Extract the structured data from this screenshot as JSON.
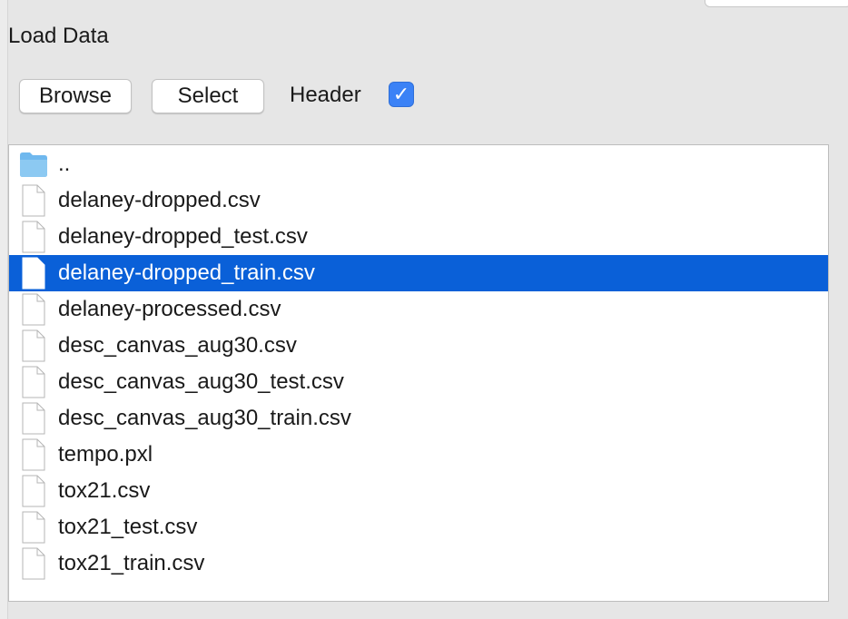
{
  "panel": {
    "title": "Load Data"
  },
  "toolbar": {
    "browse_label": "Browse",
    "select_label": "Select",
    "header_label": "Header",
    "header_checked": true,
    "checkmark": "✓"
  },
  "files": [
    {
      "name": "..",
      "icon": "folder-icon",
      "selected": false
    },
    {
      "name": "delaney-dropped.csv",
      "icon": "file-icon",
      "selected": false
    },
    {
      "name": "delaney-dropped_test.csv",
      "icon": "file-icon",
      "selected": false
    },
    {
      "name": "delaney-dropped_train.csv",
      "icon": "file-icon",
      "selected": true
    },
    {
      "name": "delaney-processed.csv",
      "icon": "file-icon",
      "selected": false
    },
    {
      "name": "desc_canvas_aug30.csv",
      "icon": "file-icon",
      "selected": false
    },
    {
      "name": "desc_canvas_aug30_test.csv",
      "icon": "file-icon",
      "selected": false
    },
    {
      "name": "desc_canvas_aug30_train.csv",
      "icon": "file-icon",
      "selected": false
    },
    {
      "name": "tempo.pxl",
      "icon": "file-icon",
      "selected": false
    },
    {
      "name": "tox21.csv",
      "icon": "file-icon",
      "selected": false
    },
    {
      "name": "tox21_test.csv",
      "icon": "file-icon",
      "selected": false
    },
    {
      "name": "tox21_train.csv",
      "icon": "file-icon",
      "selected": false
    }
  ],
  "colors": {
    "selection": "#0a60d8",
    "checkbox": "#3b82f6",
    "folder": "#6fb8ee"
  }
}
